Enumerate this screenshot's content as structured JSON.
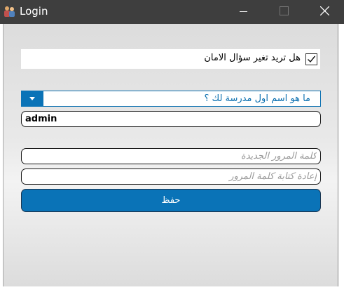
{
  "window": {
    "title": "Login",
    "icons": {
      "app": "users-icon",
      "minimize": "minimize-icon",
      "maximize": "maximize-icon",
      "close": "close-icon"
    }
  },
  "form": {
    "change_security_question": {
      "label": "هل تريد تغير سؤال الامان",
      "checked": true
    },
    "security_question": {
      "selected": "ما هو اسم اول مدرسة لك ؟",
      "dropdown_icon": "caret-down-icon"
    },
    "username": {
      "value": "admin"
    },
    "new_password": {
      "placeholder": "كلمة المرور الجديدة",
      "value": ""
    },
    "confirm_password": {
      "placeholder": "إعادة كتابة كلمة المرور",
      "value": ""
    },
    "save_label": "حفظ"
  },
  "colors": {
    "accent": "#0a73b7",
    "titlebar": "#3e3e3e"
  }
}
